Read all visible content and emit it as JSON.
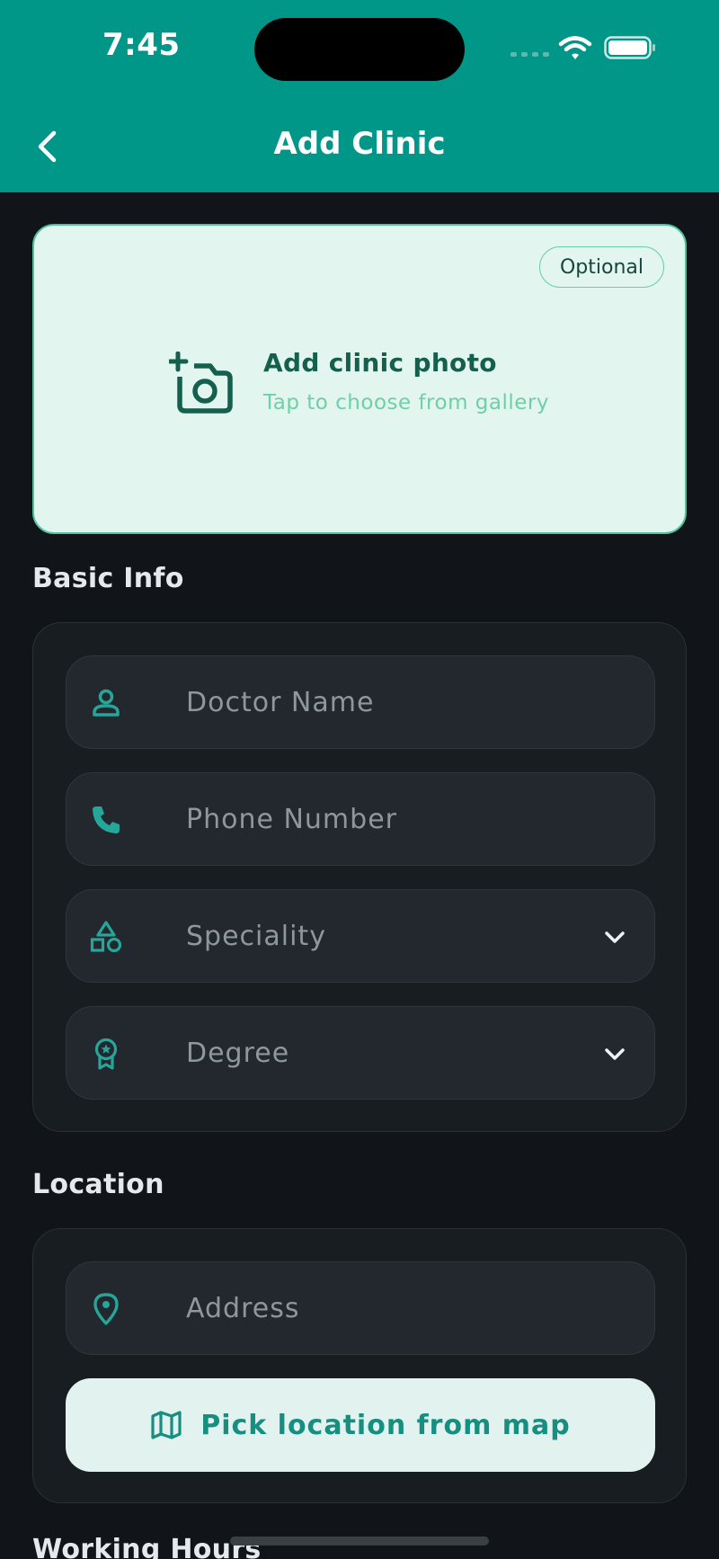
{
  "status_bar": {
    "time": "7:45"
  },
  "header": {
    "title": "Add Clinic",
    "back_icon": "chevron-left-icon"
  },
  "photo_card": {
    "badge": "Optional",
    "title": "Add clinic photo",
    "subtitle": "Tap to choose from gallery",
    "icon": "add-photo-icon"
  },
  "basic_info": {
    "title": "Basic Info",
    "fields": [
      {
        "label": "Doctor Name",
        "icon": "person-icon"
      },
      {
        "label": "Phone Number",
        "icon": "phone-icon"
      },
      {
        "label": "Speciality",
        "icon": "category-shapes-icon",
        "type": "dropdown"
      },
      {
        "label": "Degree",
        "icon": "award-badge-icon",
        "type": "dropdown"
      }
    ]
  },
  "location": {
    "title": "Location",
    "address_label": "Address",
    "address_icon": "location-pin-icon",
    "map_button": "Pick location from map",
    "map_icon": "map-icon"
  },
  "working_hours": {
    "title": "Working Hours"
  },
  "colors": {
    "primary": "#009688",
    "accent": "#26a69a",
    "background": "#111418",
    "card": "#181d21",
    "field": "#22282d",
    "photo_card": "#e3f5ef"
  }
}
